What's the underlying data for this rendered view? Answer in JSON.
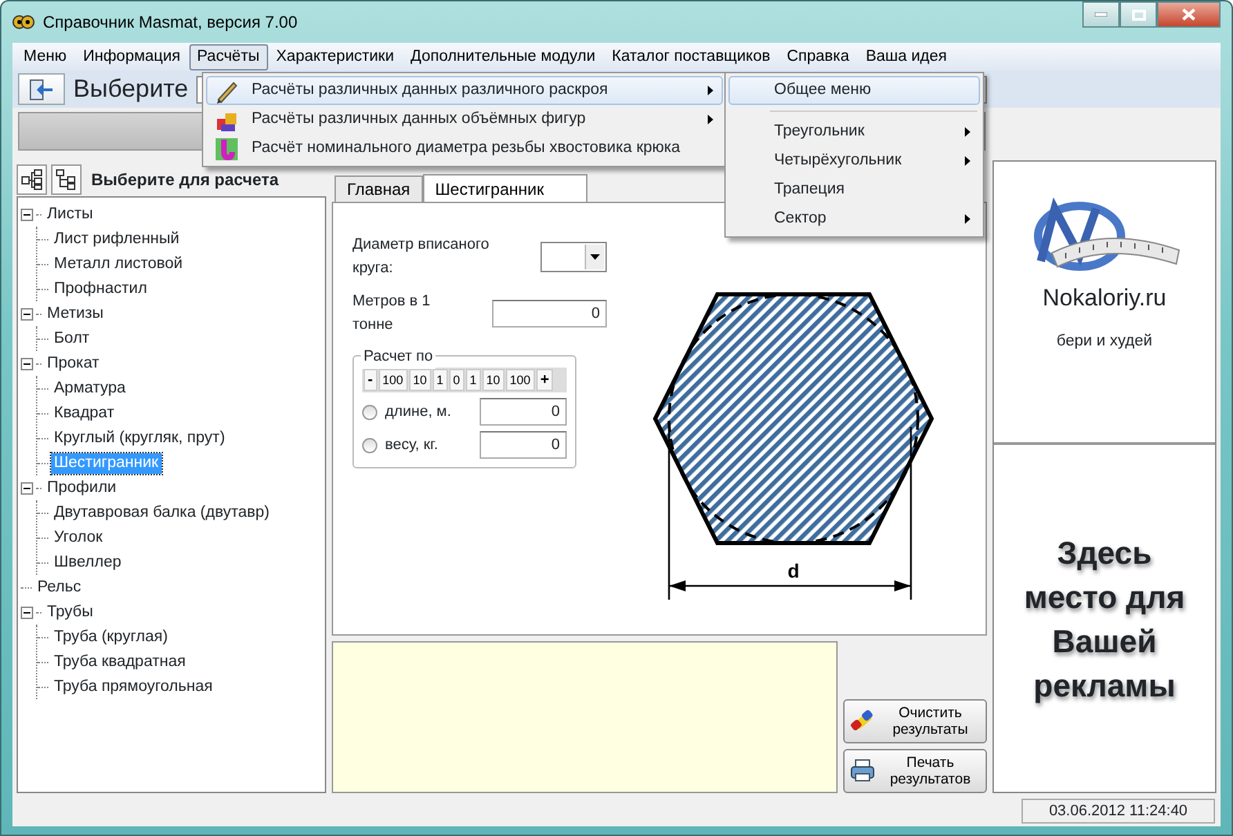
{
  "window": {
    "title": "Справочник Masmat, версия 7.00"
  },
  "menu_bar": [
    {
      "label": "Меню",
      "selected": false
    },
    {
      "label": "Информация",
      "selected": false
    },
    {
      "label": "Расчёты",
      "selected": true
    },
    {
      "label": "Характеристики",
      "selected": false
    },
    {
      "label": "Дополнительные модули",
      "selected": false
    },
    {
      "label": "Каталог поставщиков",
      "selected": false
    },
    {
      "label": "Справка",
      "selected": false
    },
    {
      "label": "Ваша идея",
      "selected": false
    }
  ],
  "toolbar": {
    "title": "Выберите"
  },
  "dropdown_menu": [
    {
      "label": "Расчёты различных данных различного раскроя",
      "has_submenu": true,
      "selected": true
    },
    {
      "label": "Расчёты различных данных объёмных фигур",
      "has_submenu": true,
      "selected": false
    },
    {
      "label": "Расчёт номинального диаметра резьбы хвостовика крюка",
      "has_submenu": false,
      "selected": false
    }
  ],
  "submenu": [
    {
      "label": "Общее меню",
      "has_submenu": false,
      "selected": true,
      "separator_after": true
    },
    {
      "label": "Треугольник",
      "has_submenu": true,
      "selected": false,
      "separator_after": false
    },
    {
      "label": "Четырёхугольник",
      "has_submenu": true,
      "selected": false,
      "separator_after": false
    },
    {
      "label": "Трапеция",
      "has_submenu": false,
      "selected": false,
      "separator_after": false
    },
    {
      "label": "Сектор",
      "has_submenu": true,
      "selected": false,
      "separator_after": false
    }
  ],
  "left_panel": {
    "title": "Выберите для расчета"
  },
  "tree": [
    {
      "label": "Листы",
      "expanded": true,
      "selected": false,
      "children": [
        {
          "label": "Лист рифленный",
          "selected": false
        },
        {
          "label": "Металл листовой",
          "selected": false
        },
        {
          "label": "Профнастил",
          "selected": false
        }
      ]
    },
    {
      "label": "Метизы",
      "expanded": true,
      "selected": false,
      "children": [
        {
          "label": "Болт",
          "selected": false
        }
      ]
    },
    {
      "label": "Прокат",
      "expanded": true,
      "selected": false,
      "children": [
        {
          "label": "Арматура",
          "selected": false
        },
        {
          "label": "Квадрат",
          "selected": false
        },
        {
          "label": "Круглый (кругляк, прут)",
          "selected": false
        },
        {
          "label": "Шестигранник",
          "selected": true
        }
      ]
    },
    {
      "label": "Профили",
      "expanded": true,
      "selected": false,
      "children": [
        {
          "label": "Двутавровая балка (двутавр)",
          "selected": false
        },
        {
          "label": "Уголок",
          "selected": false
        },
        {
          "label": "Швеллер",
          "selected": false
        }
      ]
    },
    {
      "label": "Рельс",
      "selected": false
    },
    {
      "label": "Трубы",
      "expanded": true,
      "selected": false,
      "children": [
        {
          "label": "Труба (круглая)",
          "selected": false
        },
        {
          "label": "Труба квадратная",
          "selected": false
        },
        {
          "label": "Труба прямоугольная",
          "selected": false
        }
      ]
    }
  ],
  "tabs": [
    {
      "label": "Главная",
      "selected": false
    },
    {
      "label": "Шестигранник",
      "selected": true
    }
  ],
  "form": {
    "diameter_label": "Диаметр вписаного круга:",
    "meters_label": "Метров в 1 тонне",
    "meters_value": "0",
    "group_title": "Расчет по",
    "stepper": [
      "-",
      "100",
      "10",
      "1",
      "0",
      "1",
      "10",
      "100",
      "+"
    ],
    "options": [
      {
        "label": "длине, м.",
        "selected": false,
        "value": "0"
      },
      {
        "label": "весу, кг.",
        "selected": false,
        "value": "0"
      }
    ]
  },
  "drawing": {
    "dimension_label": "d"
  },
  "buttons": [
    {
      "label": "Очистить результаты"
    },
    {
      "label": "Печать результатов"
    }
  ],
  "ads": [
    {
      "site": "Nokaloriy.ru",
      "slogan": "бери и худей"
    },
    {
      "text": "Здесь место для Вашей рекламы"
    }
  ],
  "status_bar": {
    "datetime": "03.06.2012 11:24:40"
  }
}
